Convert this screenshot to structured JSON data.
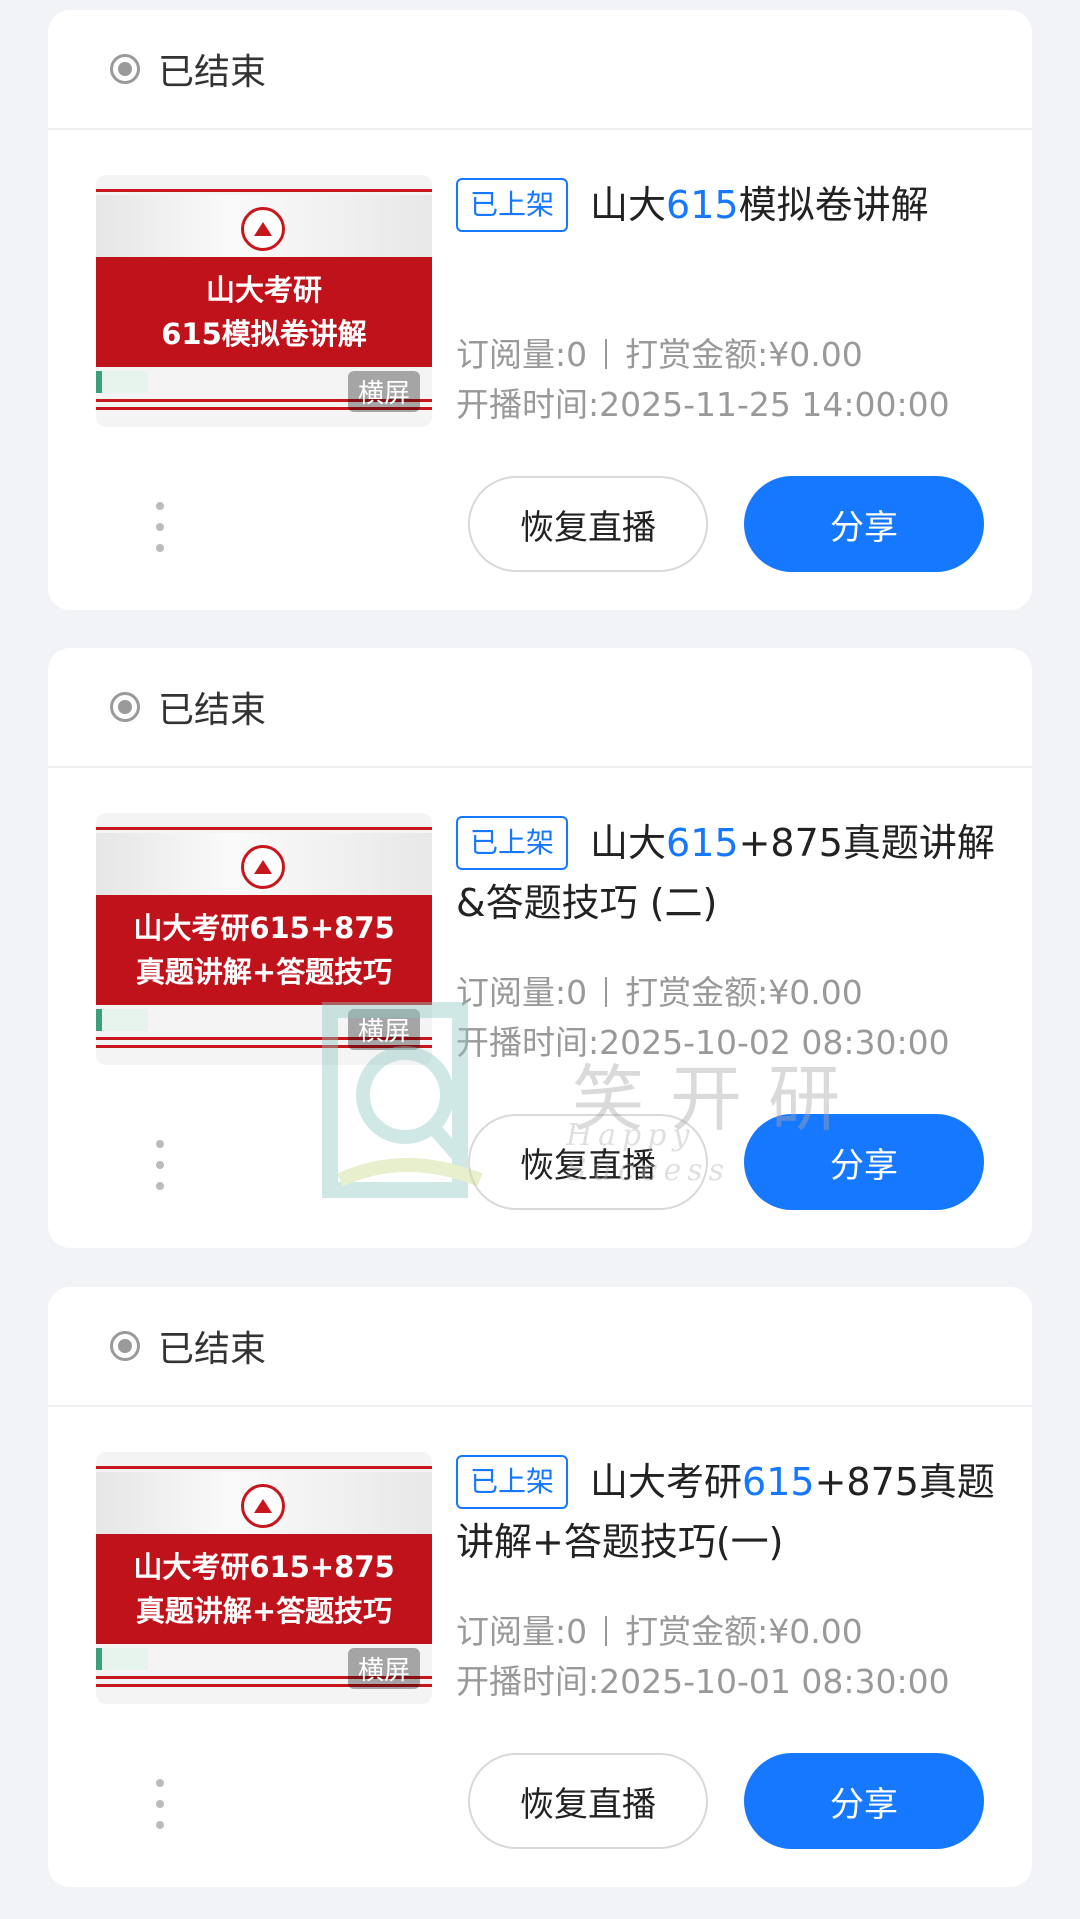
{
  "colors": {
    "accent": "#1677ff",
    "banner": "#c0121b",
    "page_bg": "#f2f3f7"
  },
  "cards": [
    {
      "status": "已结束",
      "thumb_lines": [
        "山大考研",
        "615模拟卷讲解"
      ],
      "orientation": "横屏",
      "badge": "已上架",
      "title_pre": "山大",
      "title_hl": "615",
      "title_post": "模拟卷讲解",
      "subs_label": "订阅量:0",
      "reward_label": "打赏金额:¥0.00",
      "start_label": "开播时间:2025-11-25 14:00:00",
      "resume_label": "恢复直播",
      "share_label": "分享"
    },
    {
      "status": "已结束",
      "thumb_lines": [
        "山大考研615+875",
        "真题讲解+答题技巧"
      ],
      "orientation": "横屏",
      "badge": "已上架",
      "title_pre": "山大",
      "title_hl": "615",
      "title_post": "+875真题讲解&答题技巧 (二)",
      "subs_label": "订阅量:0",
      "reward_label": "打赏金额:¥0.00",
      "start_label": "开播时间:2025-10-02 08:30:00",
      "resume_label": "恢复直播",
      "share_label": "分享"
    },
    {
      "status": "已结束",
      "thumb_lines": [
        "山大考研615+875",
        "真题讲解+答题技巧"
      ],
      "orientation": "横屏",
      "badge": "已上架",
      "title_pre": "山大考研",
      "title_hl": "615",
      "title_post": "+875真题讲解+答题技巧(一)",
      "subs_label": "订阅量:0",
      "reward_label": "打赏金额:¥0.00",
      "start_label": "开播时间:2025-10-01 08:30:00",
      "resume_label": "恢复直播",
      "share_label": "分享"
    }
  ],
  "watermark": {
    "text": "笑开研",
    "sub": "Happy Success"
  }
}
